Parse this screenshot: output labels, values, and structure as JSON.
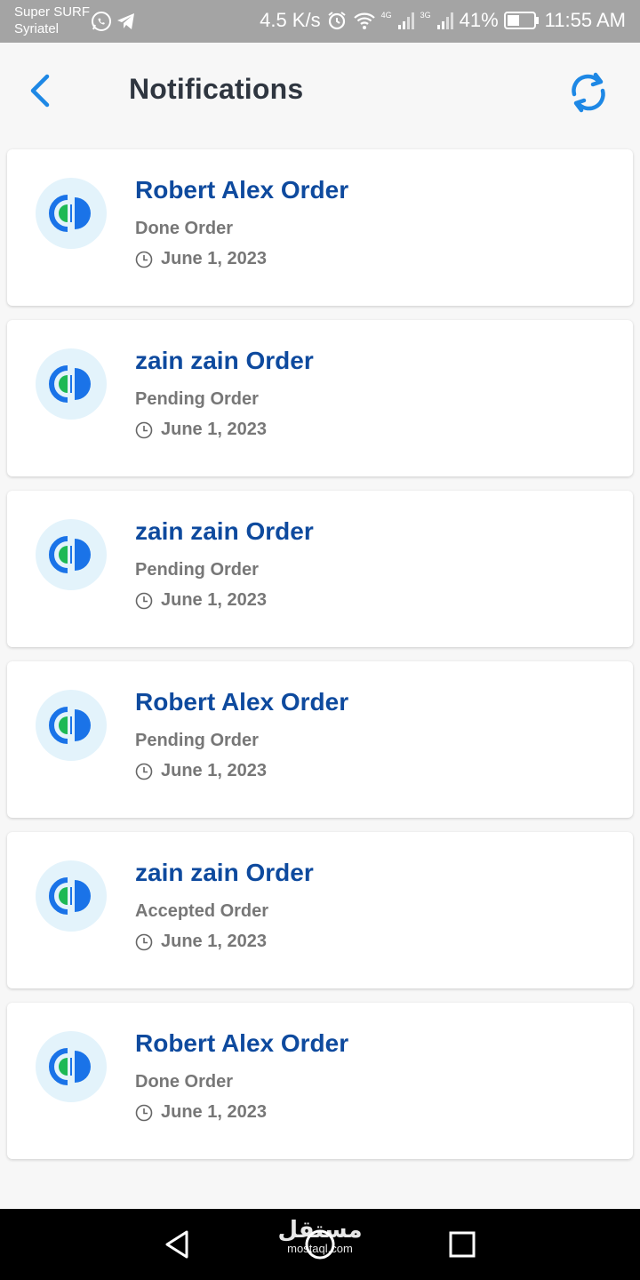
{
  "status_bar": {
    "carrier_line1": "Super SURF",
    "carrier_line2": "Syriatel",
    "speed": "4.5 K/s",
    "net1": "4G",
    "net2": "3G",
    "battery": "41%",
    "time": "11:55 AM"
  },
  "header": {
    "title": "Notifications",
    "back_icon": "chevron-left-icon",
    "refresh_icon": "refresh-icon"
  },
  "notifications": [
    {
      "title": "Robert Alex Order",
      "status": "Done Order",
      "date": "June 1, 2023"
    },
    {
      "title": "zain zain Order",
      "status": "Pending Order",
      "date": "June 1, 2023"
    },
    {
      "title": "zain zain Order",
      "status": "Pending Order",
      "date": "June 1, 2023"
    },
    {
      "title": "Robert Alex Order",
      "status": "Pending Order",
      "date": "June 1, 2023"
    },
    {
      "title": "zain zain Order",
      "status": "Accepted Order",
      "date": "June 1, 2023"
    },
    {
      "title": "Robert Alex Order",
      "status": "Done Order",
      "date": "June 1, 2023"
    }
  ],
  "watermark": {
    "arabic": "مستقل",
    "url": "mostaql.com"
  },
  "colors": {
    "accent": "#1e88e5",
    "title": "#0e4a9e",
    "logo_green": "#1db954",
    "logo_blue": "#1a73e8"
  }
}
